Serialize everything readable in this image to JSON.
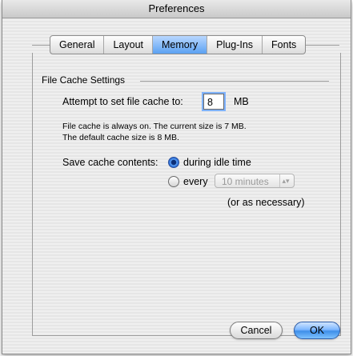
{
  "window": {
    "title": "Preferences"
  },
  "tabs": [
    {
      "label": "General"
    },
    {
      "label": "Layout"
    },
    {
      "label": "Memory",
      "active": true
    },
    {
      "label": "Plug-Ins"
    },
    {
      "label": "Fonts"
    }
  ],
  "file_cache": {
    "group_title": "File Cache Settings",
    "attempt_label": "Attempt to set file cache to:",
    "cache_value": "8",
    "unit": "MB",
    "info_line1": "File cache is always on.  The current size is 7 MB.",
    "info_line2": "The default cache size is 8 MB.",
    "save_label": "Save cache contents:",
    "option_idle": "during idle time",
    "option_every": "every",
    "interval_value": "10 minutes",
    "as_necessary": "(or as necessary)"
  },
  "buttons": {
    "cancel": "Cancel",
    "ok": "OK"
  },
  "colors": {
    "accent": "#5ba1f2",
    "window_bg": "#ececec"
  }
}
